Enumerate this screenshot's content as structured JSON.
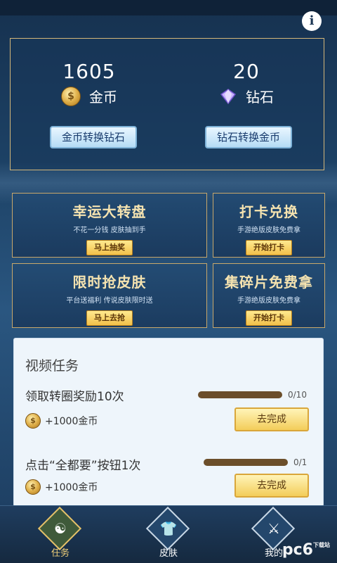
{
  "header": {
    "info_icon": "info-icon"
  },
  "wallet": {
    "coins": {
      "amount": "1605",
      "label": "金币"
    },
    "diamonds": {
      "amount": "20",
      "label": "钻石"
    },
    "coin_to_diamond": "金币转换钻石",
    "diamond_to_coin": "钻石转换金币"
  },
  "cards": [
    {
      "title": "幸运大转盘",
      "subtitle": "不花一分钱 皮肤抽到手",
      "action": "马上抽奖"
    },
    {
      "title": "打卡兑换",
      "subtitle": "手游绝版皮肤免费拿",
      "action": "开始打卡"
    },
    {
      "title": "限时抢皮肤",
      "subtitle": "平台送福利 传说皮肤限时送",
      "action": "马上去抢"
    },
    {
      "title": "集碎片免费拿",
      "subtitle": "手游绝版皮肤免费拿",
      "action": "开始打卡"
    }
  ],
  "tasks": {
    "title": "视频任务",
    "items": [
      {
        "name": "领取转圈奖励10次",
        "progress": "0/10",
        "progress_fraction": 0.0,
        "reward": "+1000金币",
        "button": "去完成"
      },
      {
        "name": "点击“全都要”按钮1次",
        "progress": "0/1",
        "progress_fraction": 0.0,
        "reward": "+1000金币",
        "button": "去完成"
      }
    ]
  },
  "tabs": [
    {
      "label": "任务",
      "icon": "task-icon",
      "active": true
    },
    {
      "label": "皮肤",
      "icon": "skin-icon",
      "active": false
    },
    {
      "label": "我的",
      "icon": "profile-icon",
      "active": false
    }
  ],
  "watermark": {
    "text": "pc6",
    "sub": "下载站"
  }
}
